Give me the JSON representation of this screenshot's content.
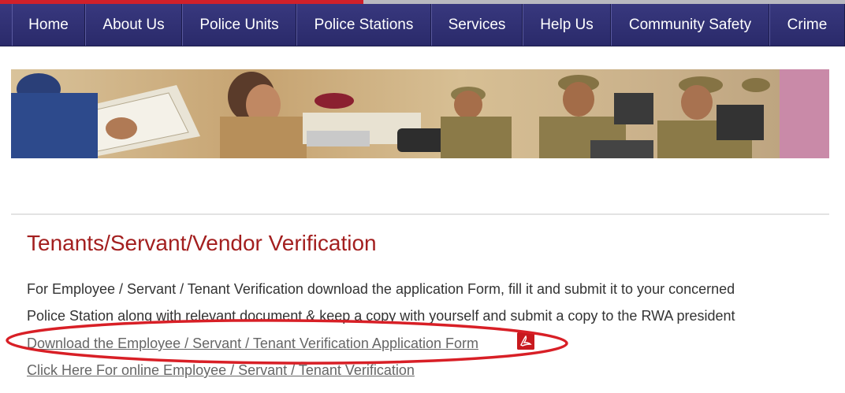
{
  "nav": {
    "items": [
      {
        "label": "Home"
      },
      {
        "label": "About Us"
      },
      {
        "label": "Police Units"
      },
      {
        "label": "Police Stations"
      },
      {
        "label": "Services"
      },
      {
        "label": "Help Us"
      },
      {
        "label": "Community Safety"
      },
      {
        "label": "Crime"
      }
    ]
  },
  "content": {
    "title": "Tenants/Servant/Vendor Verification",
    "paragraph_line1": "For Employee / Servant / Tenant Verification download the application Form, fill it and submit it to your concerned",
    "paragraph_line2": "Police Station along with relevant document & keep a copy with yourself and submit a copy to the RWA president",
    "download_link": "Download the Employee / Servant / Tenant Verification Application Form",
    "online_link": "Click Here For online Employee / Servant / Tenant Verification"
  },
  "icons": {
    "pdf": "pdf-icon"
  },
  "colors": {
    "nav_bg": "#2e2e72",
    "title": "#a31f1f",
    "annotation": "#d81f26",
    "accent_strip": "#d0202a"
  }
}
